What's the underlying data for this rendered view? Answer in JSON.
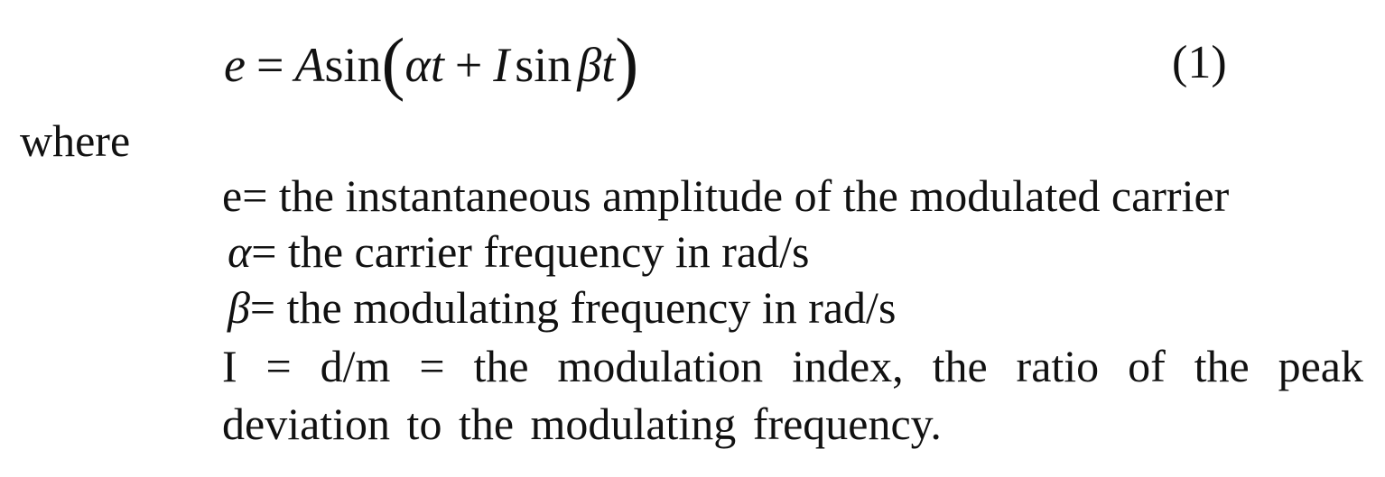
{
  "equation": {
    "lhs": "e",
    "equals": "=",
    "coef": "A",
    "fn1": "sin",
    "open_paren": "(",
    "alpha": "α",
    "t1": "t",
    "plus": "+",
    "index": "I",
    "fn2": "sin",
    "beta": "β",
    "t2": "t",
    "close_paren": ")",
    "number": "(1)"
  },
  "where_label": "where",
  "definitions": [
    {
      "symbol": "e",
      "text": " = the instantaneous amplitude of the modulated carrier"
    },
    {
      "symbol": "α",
      "text": " = the carrier frequency in rad/s"
    },
    {
      "symbol": "β",
      "text": " = the modulating frequency in rad/s"
    },
    {
      "symbol": "I",
      "text": " = d/m = the modulation index, the ratio of the peak deviation to the modulating frequency."
    }
  ]
}
